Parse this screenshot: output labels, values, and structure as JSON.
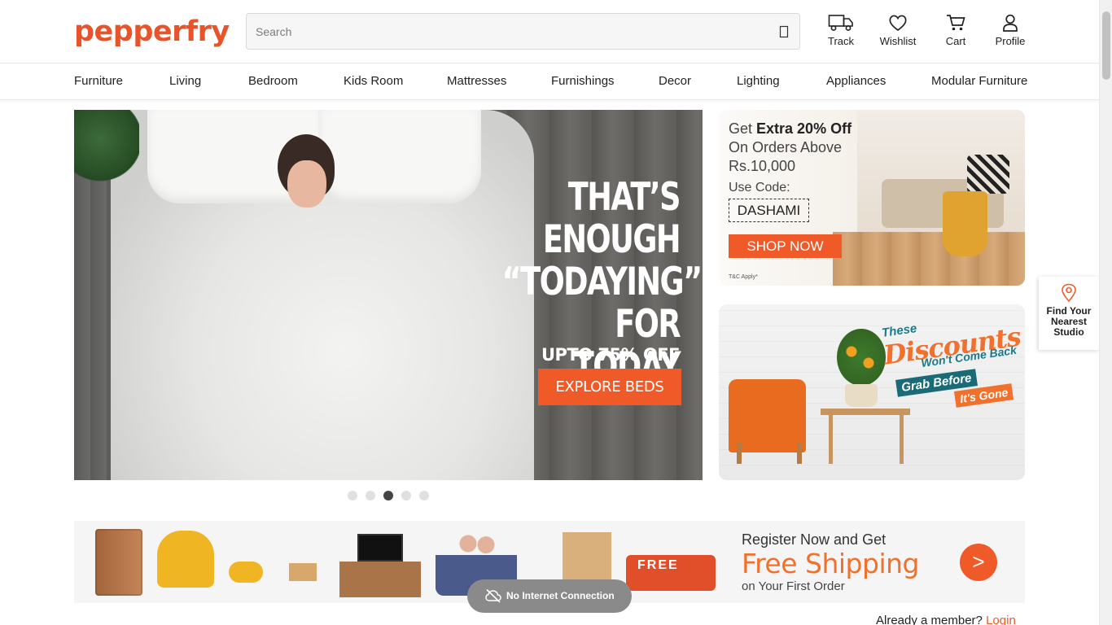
{
  "header": {
    "logo": "pepperfry",
    "search_placeholder": "Search",
    "actions": [
      {
        "label": "Track",
        "icon": "truck-icon"
      },
      {
        "label": "Wishlist",
        "icon": "heart-icon"
      },
      {
        "label": "Cart",
        "icon": "cart-icon"
      },
      {
        "label": "Profile",
        "icon": "user-icon"
      }
    ]
  },
  "nav": {
    "items": [
      "Furniture",
      "Living",
      "Bedroom",
      "Kids Room",
      "Mattresses",
      "Furnishings",
      "Decor",
      "Lighting",
      "Appliances",
      "Modular Furniture"
    ]
  },
  "hero": {
    "headline_lines": [
      "THAT’S",
      "ENOUGH",
      "“TODAYING”",
      "FOR TODAY"
    ],
    "offer": "UPTO 75% OFF",
    "cta": "EXPLORE BEDS",
    "carousel_dots": 5,
    "active_dot": 3
  },
  "promo1": {
    "line1_pre": "Get ",
    "line1_bold": "Extra 20% Off",
    "line2": "On Orders Above",
    "line3": "Rs.10,000",
    "code_label": "Use Code:",
    "code": "DASHAMI",
    "cta": "SHOP NOW",
    "terms": "T&C Apply*"
  },
  "promo2": {
    "these": "These",
    "discounts": "Discounts",
    "wont": "Won't Come Back",
    "grab": "Grab Before",
    "gone": "It's Gone"
  },
  "studio": {
    "label_lines": [
      "Find Your",
      "Nearest",
      "Studio"
    ]
  },
  "shipping_banner": {
    "truck_text": "FREE",
    "line1": "Register Now and Get",
    "headline": "Free Shipping",
    "line3": "on Your First Order",
    "arrow": ">"
  },
  "toast": {
    "text": "No Internet Connection"
  },
  "member": {
    "prompt": "Already a member?",
    "login": "Login"
  },
  "colors": {
    "brand": "#e8532a",
    "accent_orange": "#f05a28",
    "teal": "#1b6a78"
  }
}
